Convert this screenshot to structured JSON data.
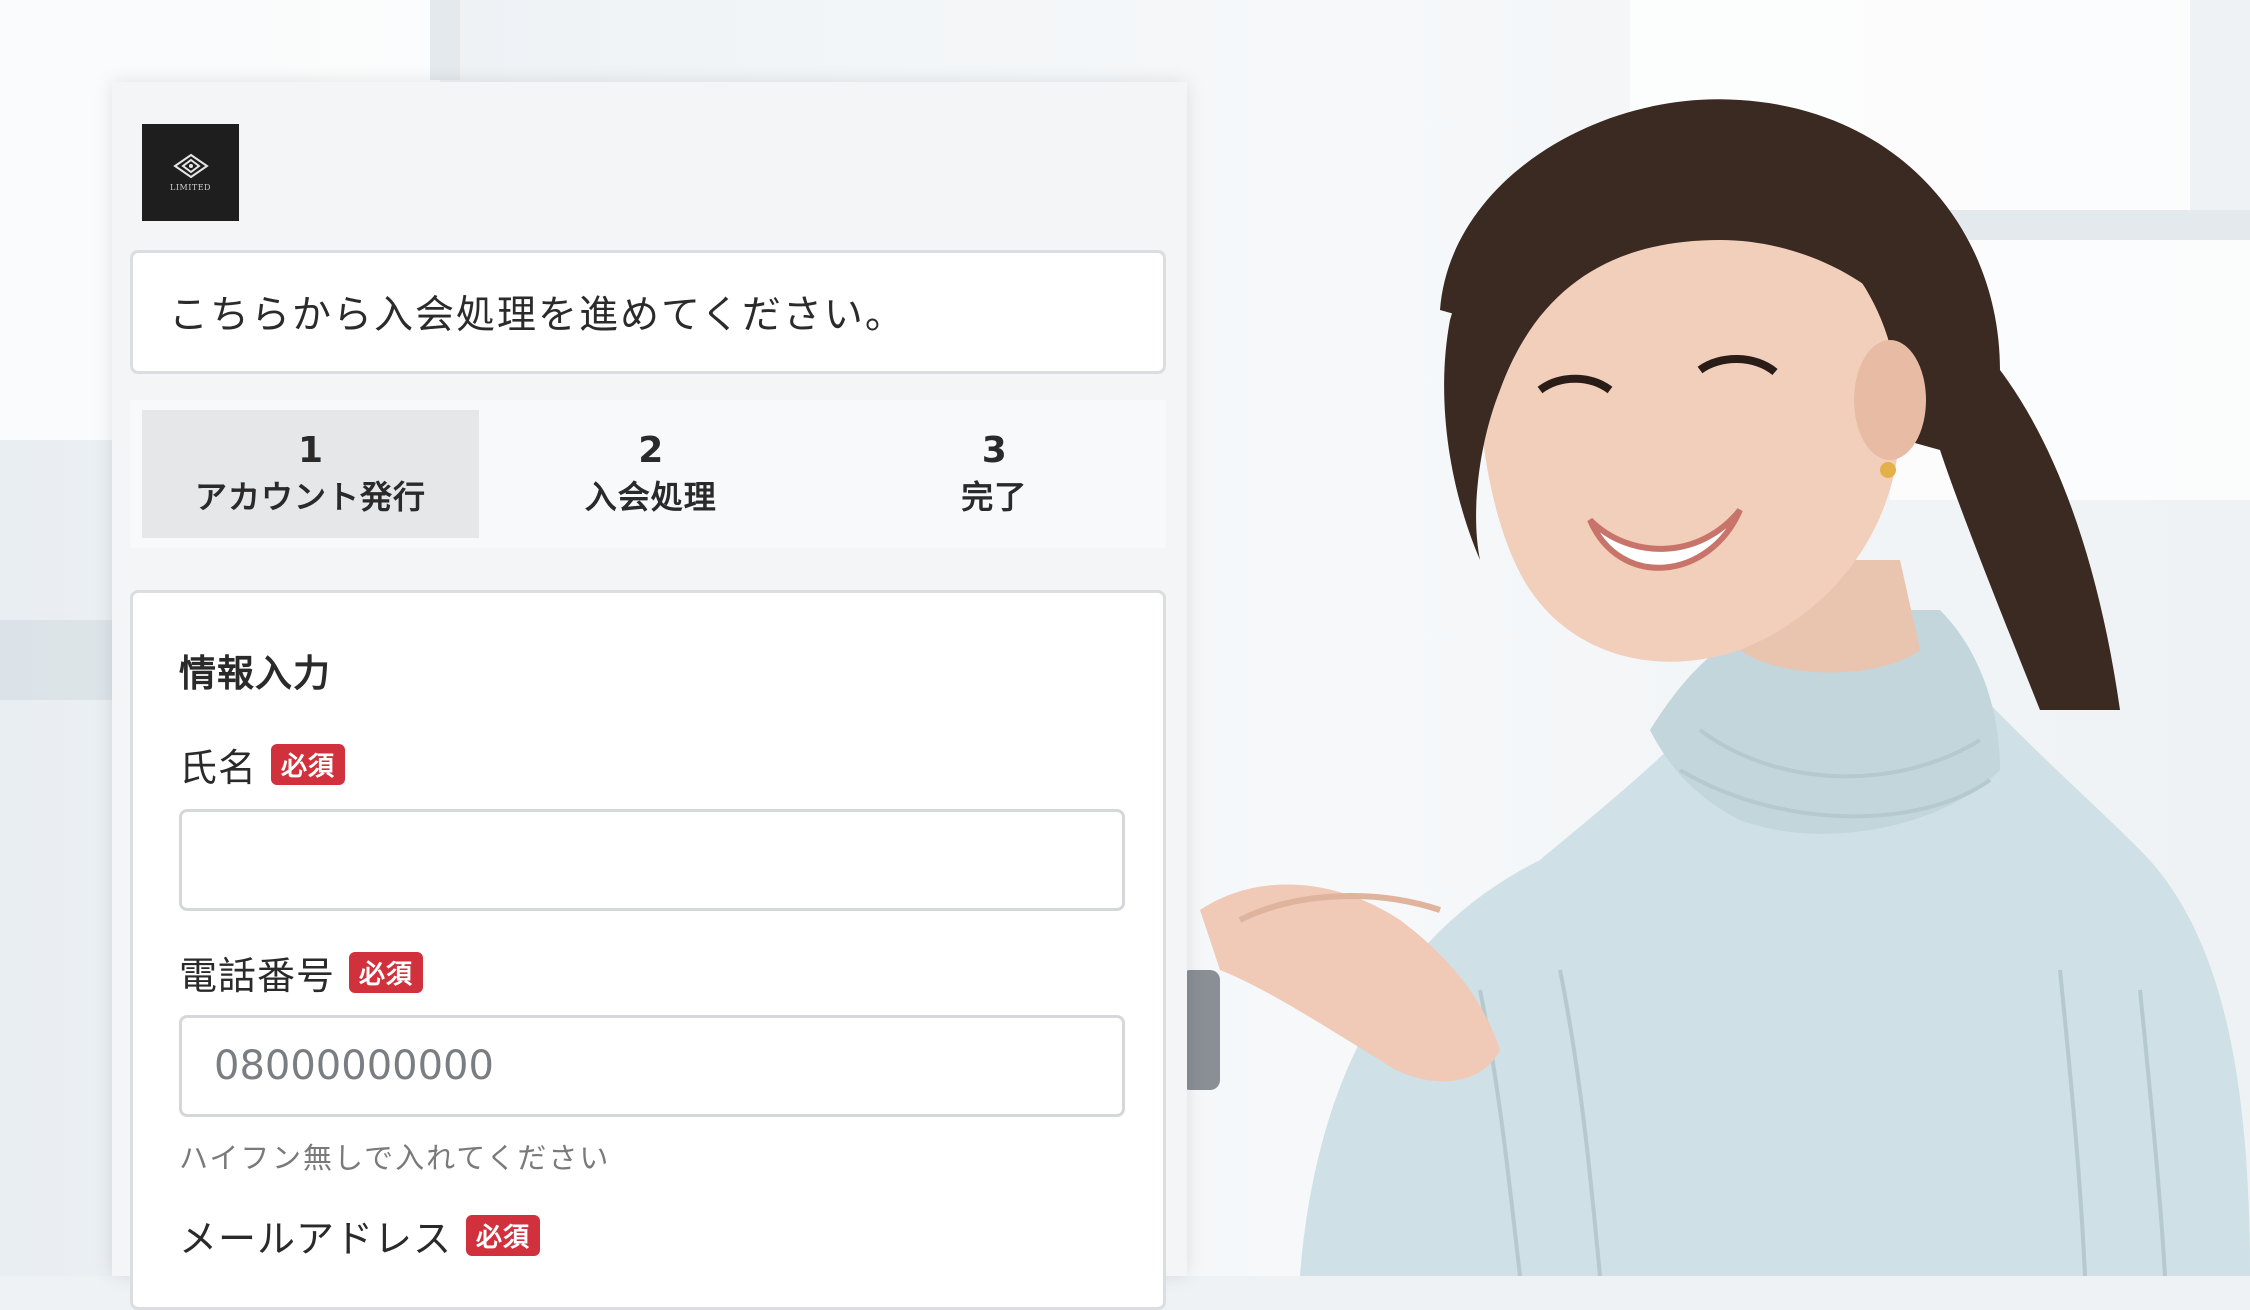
{
  "logo": {
    "text": "LIMITED"
  },
  "intro": {
    "text": "こちらから入会処理を進めてください。"
  },
  "steps": [
    {
      "number": "1",
      "label": "アカウント発行",
      "active": true
    },
    {
      "number": "2",
      "label": "入会処理",
      "active": false
    },
    {
      "number": "3",
      "label": "完了",
      "active": false
    }
  ],
  "form": {
    "title": "情報入力",
    "required_badge": "必須",
    "fields": [
      {
        "label": "氏名",
        "value": "",
        "placeholder": ""
      },
      {
        "label": "電話番号",
        "value": "",
        "placeholder": "08000000000",
        "hint": "ハイフン無しで入れてください"
      },
      {
        "label": "メールアドレス"
      }
    ]
  },
  "colors": {
    "badge": "#d0313c",
    "panel_bg": "#f4f5f7",
    "active_step": "#e6e7e8"
  }
}
